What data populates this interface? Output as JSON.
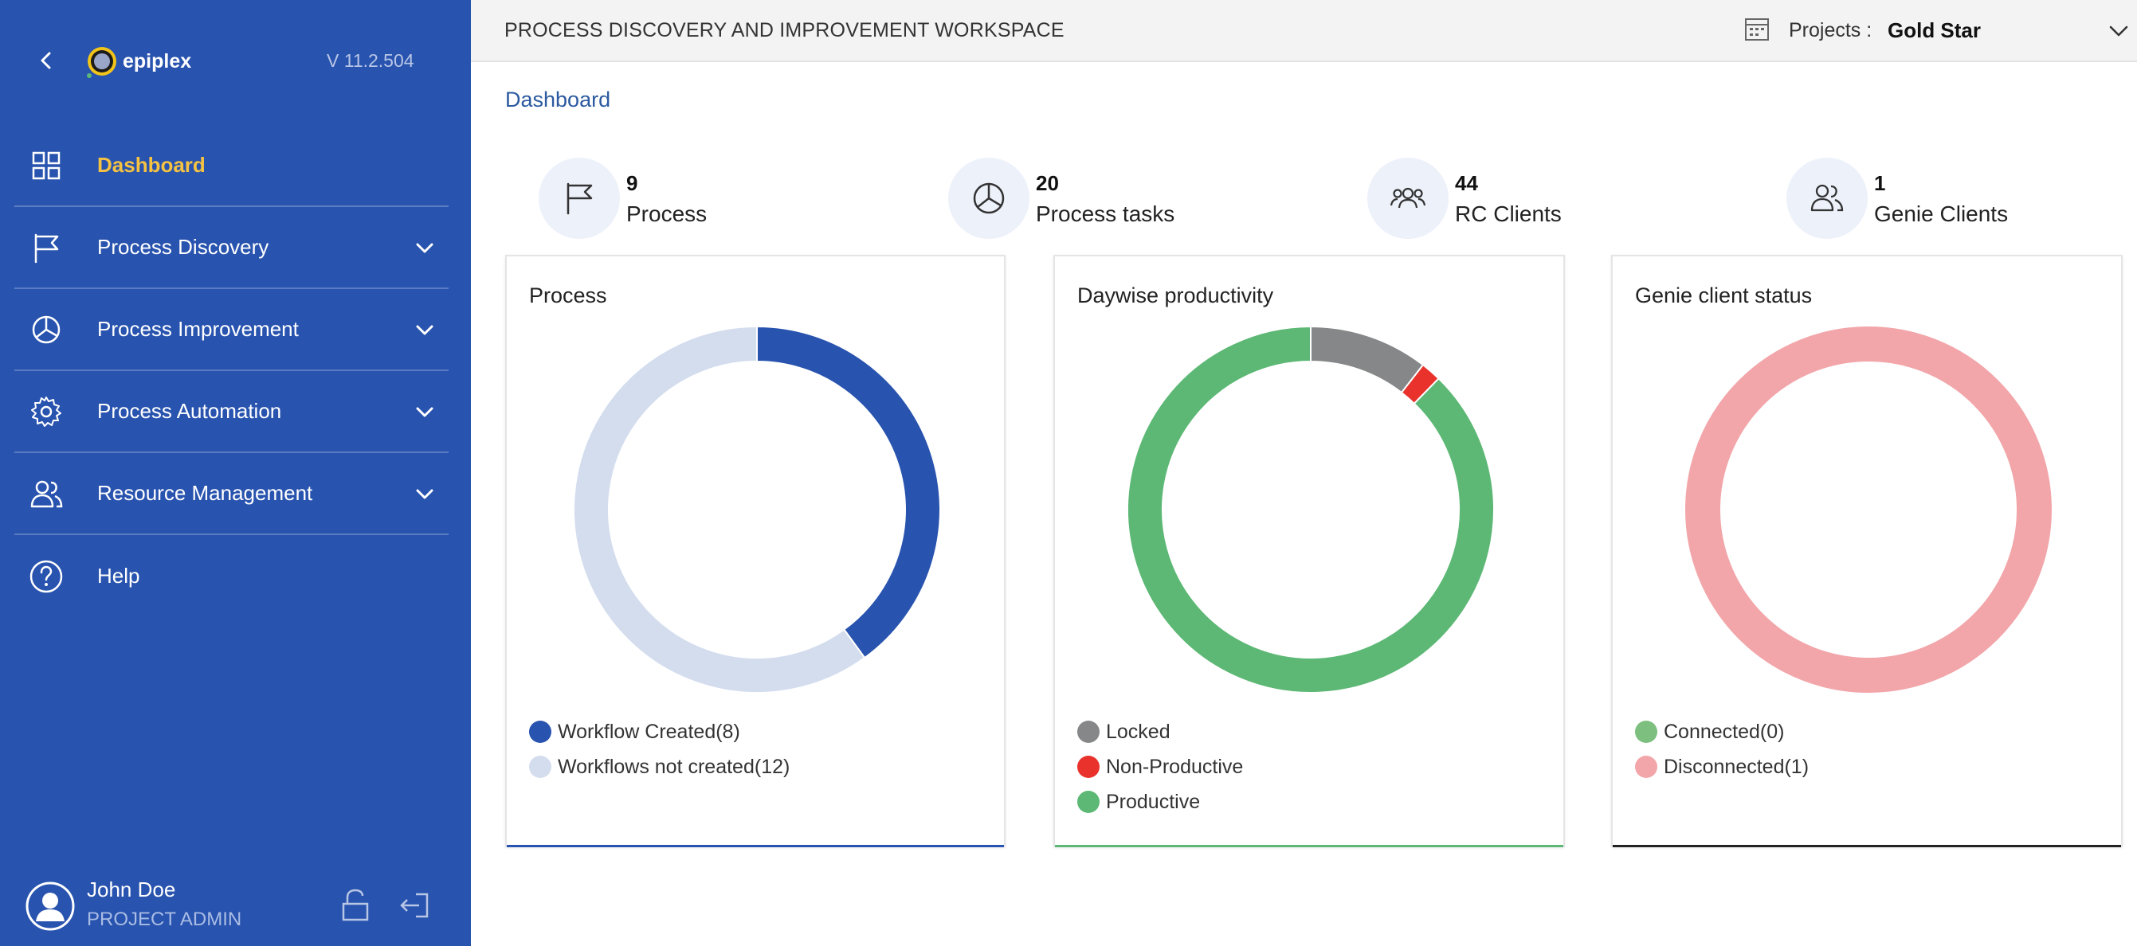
{
  "sidebar": {
    "logo_text": "epiplex",
    "version": "V 11.2.504",
    "items": [
      {
        "label": "Dashboard",
        "icon": "grid-icon",
        "active": true
      },
      {
        "label": "Process Discovery",
        "icon": "flag-icon"
      },
      {
        "label": "Process Improvement",
        "icon": "pie-icon"
      },
      {
        "label": "Process Automation",
        "icon": "gear-icon"
      },
      {
        "label": "Resource Management",
        "icon": "users-icon"
      },
      {
        "label": "Help",
        "icon": "help-icon"
      }
    ],
    "user": {
      "name": "John Doe",
      "role": "PROJECT ADMIN"
    }
  },
  "header": {
    "title": "PROCESS DISCOVERY AND IMPROVEMENT WORKSPACE",
    "projects_label": "Projects :",
    "projects_value": "Gold Star"
  },
  "breadcrumb": "Dashboard",
  "stats": [
    {
      "value": "9",
      "label": "Process",
      "icon": "flag-icon"
    },
    {
      "value": "20",
      "label": "Process tasks",
      "icon": "pie-icon"
    },
    {
      "value": "44",
      "label": "RC Clients",
      "icon": "group-icon"
    },
    {
      "value": "1",
      "label": "Genie Clients",
      "icon": "users-icon"
    }
  ],
  "colors": {
    "sidebar": "#2853ae",
    "active": "#f5c242",
    "blue": "#2853ae",
    "light_blue": "#d3ddee",
    "gray": "#858788",
    "red": "#e8322b",
    "green": "#5cb874",
    "connected": "#7cbf7e",
    "pink": "#f2a6aa"
  },
  "chart_data": [
    {
      "type": "pie",
      "title": "Process",
      "labels": [
        "Workflow Created(8)",
        "Workflows not created(12)"
      ],
      "values": [
        8,
        12
      ],
      "colors": [
        "#2853ae",
        "#d3ddee"
      ]
    },
    {
      "type": "pie",
      "title": "Daywise productivity",
      "labels": [
        "Locked",
        "Non-Productive",
        "Productive"
      ],
      "values": [
        10.5,
        1.8,
        87.7
      ],
      "colors": [
        "#858788",
        "#e8322b",
        "#5cb874"
      ]
    },
    {
      "type": "pie",
      "title": "Genie client status",
      "labels": [
        "Connected(0)",
        "Disconnected(1)"
      ],
      "values": [
        0,
        1
      ],
      "colors": [
        "#7cbf7e",
        "#f2a6aa"
      ]
    }
  ]
}
